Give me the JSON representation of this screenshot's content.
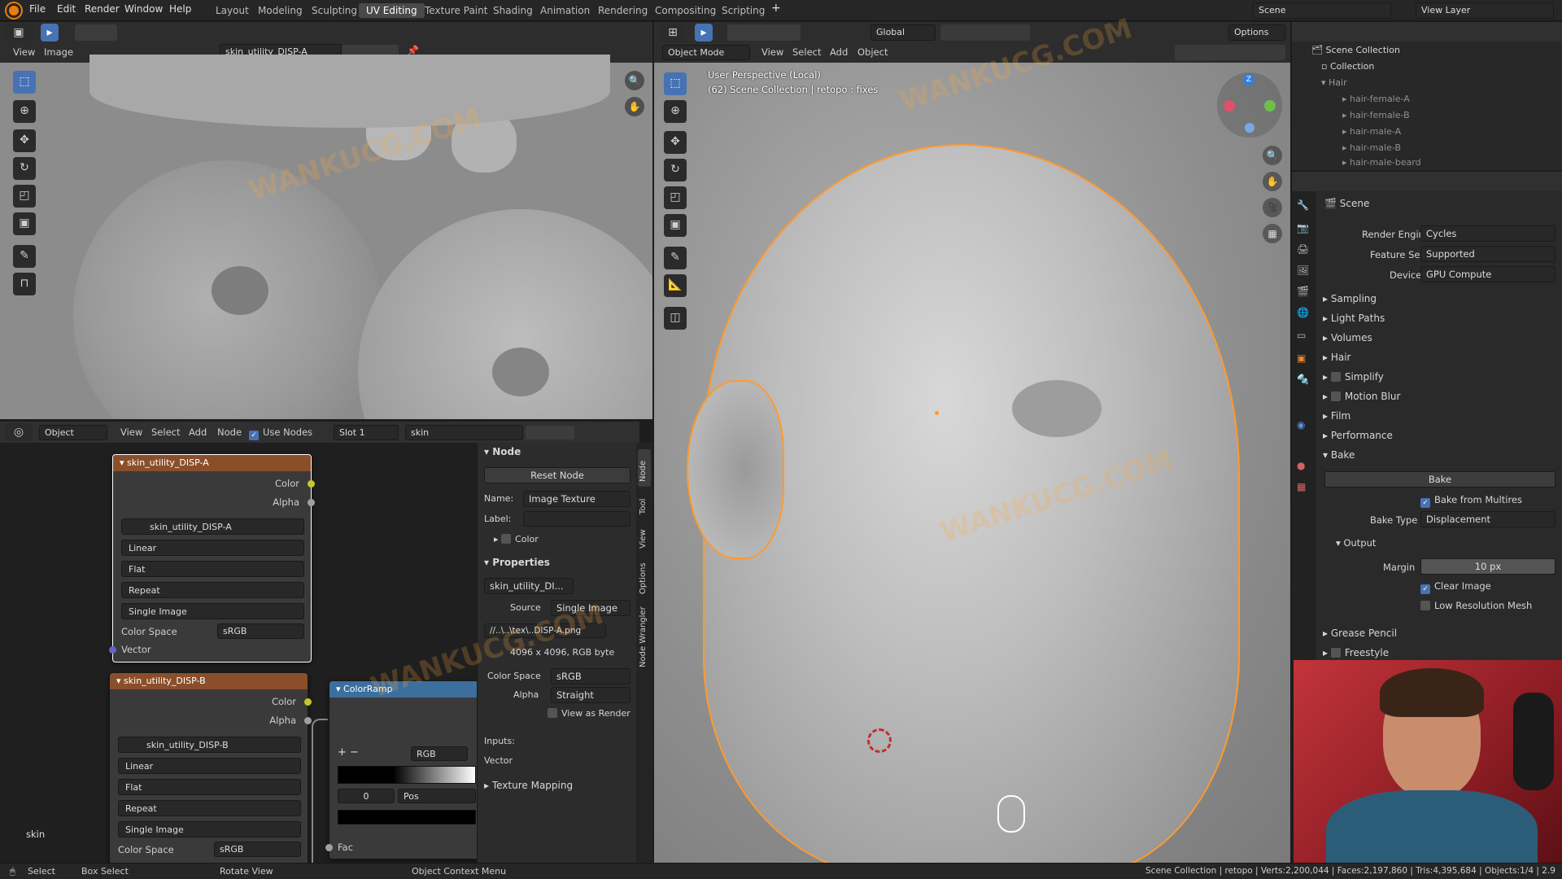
{
  "menus": [
    "File",
    "Edit",
    "Render",
    "Window",
    "Help"
  ],
  "workspaces": [
    "Layout",
    "Modeling",
    "Sculpting",
    "UV Editing",
    "Texture Paint",
    "Shading",
    "Animation",
    "Rendering",
    "Compositing",
    "Scripting"
  ],
  "active_workspace": "UV Editing",
  "scene_name": "Scene",
  "view_layer": "View Layer",
  "image_editor": {
    "menus": [
      "View",
      "Image"
    ],
    "image_name": "skin_utility_DISP-A"
  },
  "viewport": {
    "mode": "Object Mode",
    "menus": [
      "View",
      "Select",
      "Add",
      "Object"
    ],
    "orientation": "Global",
    "options": "Options",
    "info_line1": "User Perspective (Local)",
    "info_line2": "(62) Scene Collection | retopo : fixes"
  },
  "node_editor": {
    "editor": "Object",
    "menus": [
      "View",
      "Select",
      "Add",
      "Node"
    ],
    "use_nodes": "Use Nodes",
    "slot": "Slot 1",
    "material": "skin",
    "label_bottom": "skin",
    "nodeA": {
      "title": "skin_utility_DISP-A",
      "out1": "Color",
      "out2": "Alpha",
      "image": "skin_utility_DISP-A",
      "interp": "Linear",
      "proj": "Flat",
      "ext": "Repeat",
      "source": "Single Image",
      "cs_label": "Color Space",
      "cs": "sRGB",
      "vector": "Vector"
    },
    "nodeB": {
      "title": "skin_utility_DISP-B",
      "out1": "Color",
      "out2": "Alpha",
      "image": "skin_utility_DISP-B",
      "interp": "Linear",
      "proj": "Flat",
      "ext": "Repeat",
      "source": "Single Image",
      "cs_label": "Color Space",
      "cs": "sRGB"
    },
    "ramp": {
      "title": "ColorRamp",
      "mode": "RGB",
      "pos_value": "0",
      "pos_label": "Pos",
      "fac": "Fac"
    }
  },
  "sidebar": {
    "tabs": [
      "Node",
      "Tool",
      "View",
      "Options",
      "Node Wrangler"
    ],
    "node_header": "Node",
    "reset": "Reset Node",
    "name_label": "Name:",
    "name_value": "Image Texture",
    "label_label": "Label:",
    "color": "Color",
    "properties": "Properties",
    "image_name": "skin_utility_DI...",
    "source_label": "Source",
    "source": "Single Image",
    "filepath": "//..\\..\\tex\\..DISP-A.png",
    "resolution": "4096 x 4096, RGB byte",
    "cs_label": "Color Space",
    "cs": "sRGB",
    "alpha_label": "Alpha",
    "alpha": "Straight",
    "view_as_render": "View as Render",
    "inputs": "Inputs:",
    "vector": "Vector",
    "texture_mapping": "Texture Mapping"
  },
  "outliner": {
    "scene_collection": "Scene Collection",
    "collection": "Collection",
    "hair": "Hair",
    "items": [
      "hair-female-A",
      "hair-female-B",
      "hair-male-A",
      "hair-male-B",
      "hair-male-beard"
    ]
  },
  "properties": {
    "header": "Scene",
    "render_engine_label": "Render Engine",
    "render_engine": "Cycles",
    "feature_set_label": "Feature Set",
    "feature_set": "Supported",
    "device_label": "Device",
    "device": "GPU Compute",
    "panels": [
      "Sampling",
      "Light Paths",
      "Volumes",
      "Hair",
      "Simplify",
      "Motion Blur",
      "Film",
      "Performance"
    ],
    "bake": "Bake",
    "bake_button": "Bake",
    "bake_multires": "Bake from Multires",
    "bake_type_label": "Bake Type",
    "bake_type": "Displacement",
    "output": "Output",
    "margin_label": "Margin",
    "margin": "10 px",
    "clear_image": "Clear Image",
    "low_res": "Low Resolution Mesh",
    "grease_pencil": "Grease Pencil",
    "freestyle": "Freestyle"
  },
  "status": {
    "select": "Select",
    "box_select": "Box Select",
    "rotate": "Rotate View",
    "context": "Object Context Menu",
    "stats": "Scene Collection | retopo | Verts:2,200,044 | Faces:2,197,860 | Tris:4,395,684 | Objects:1/4 | 2.9"
  },
  "watermark": "WANKUCG.COM",
  "colors": {
    "accent": "#4772b3",
    "node_header_texture": "#8a4f2a",
    "node_header_converter": "#3c6e9e",
    "selection_outline": "#ff9a2e",
    "socket_color": "#c7c729",
    "socket_vector": "#6363c7"
  }
}
